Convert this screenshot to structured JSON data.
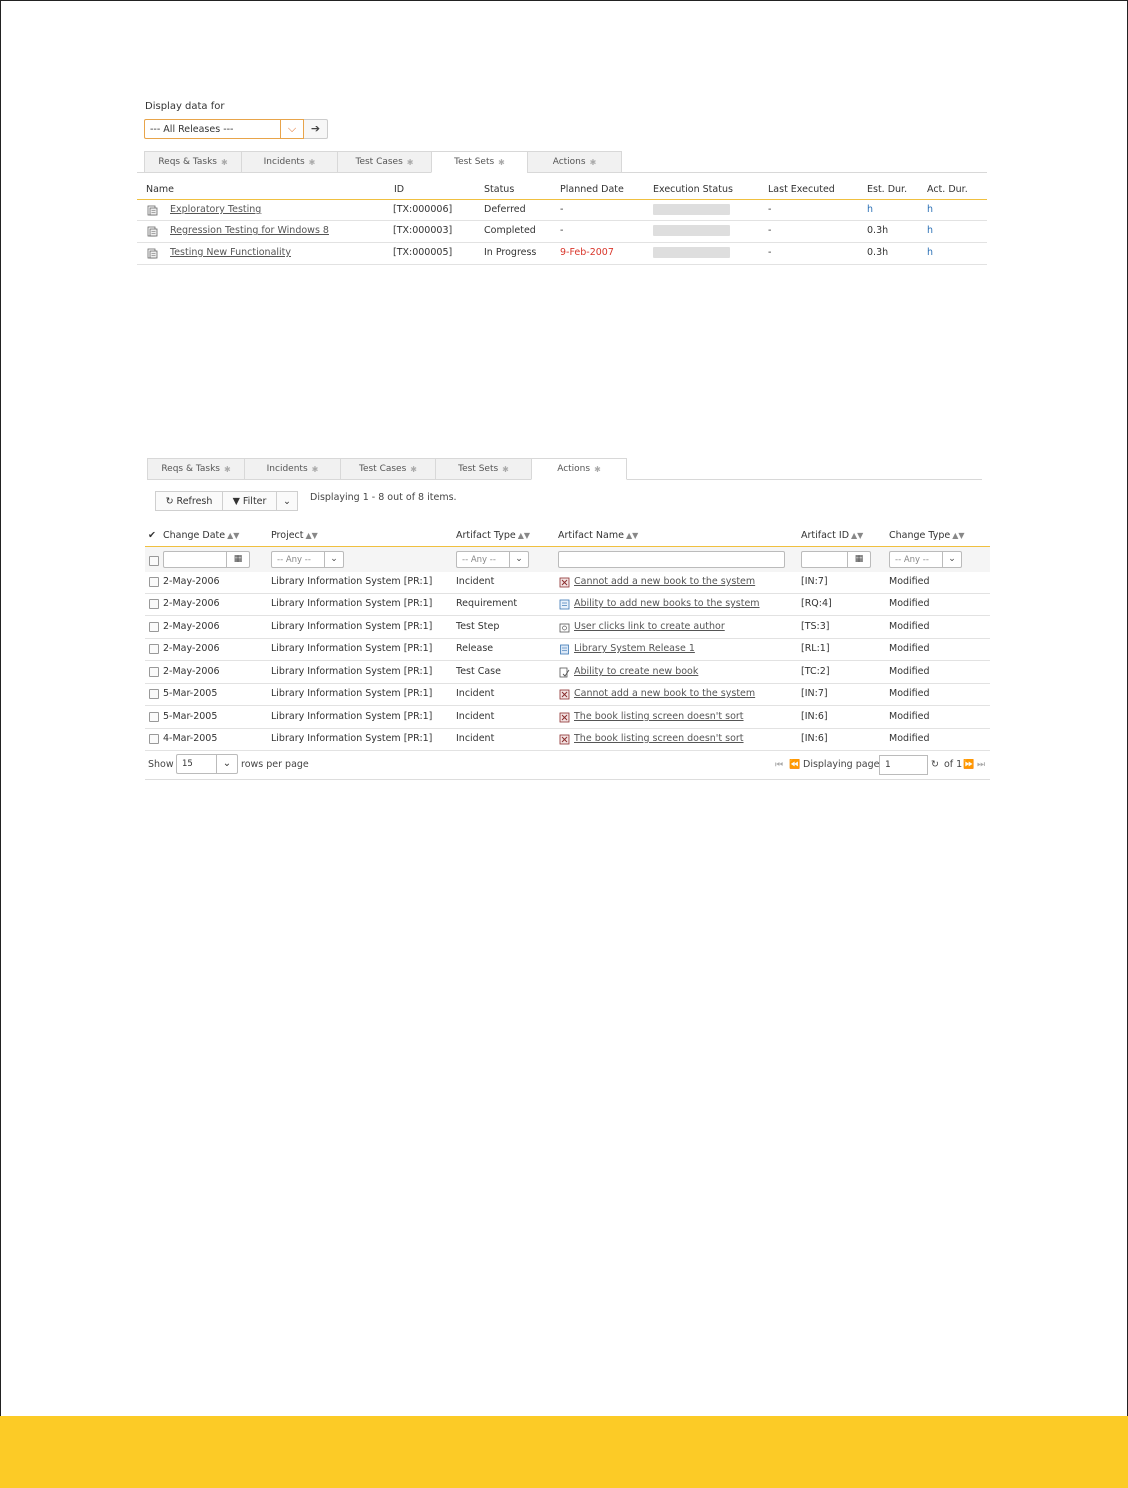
{
  "release_filter": {
    "label": "Display data for",
    "selected": "--- All Releases ---"
  },
  "tabs_top": [
    {
      "label": "Reqs & Tasks",
      "active": false
    },
    {
      "label": "Incidents",
      "active": false
    },
    {
      "label": "Test Cases",
      "active": false
    },
    {
      "label": "Test Sets",
      "active": true
    },
    {
      "label": "Actions",
      "active": false
    }
  ],
  "test_sets": {
    "columns": [
      "Name",
      "ID",
      "Status",
      "Planned Date",
      "Execution Status",
      "Last Executed",
      "Est. Dur.",
      "Act. Dur."
    ],
    "rows": [
      {
        "name": "Exploratory Testing",
        "id": "[TX:000006]",
        "status": "Deferred",
        "planned": "-",
        "last": "-",
        "est": "h",
        "act": "h"
      },
      {
        "name": "Regression Testing for Windows 8",
        "id": "[TX:000003]",
        "status": "Completed",
        "planned": "-",
        "last": "-",
        "est": "0.3h",
        "act": "h"
      },
      {
        "name": "Testing New Functionality",
        "id": "[TX:000005]",
        "status": "In Progress",
        "planned": "9-Feb-2007",
        "last": "-",
        "est": "0.3h",
        "act": "h"
      }
    ]
  },
  "tabs_bottom": [
    {
      "label": "Reqs & Tasks",
      "active": false
    },
    {
      "label": "Incidents",
      "active": false
    },
    {
      "label": "Test Cases",
      "active": false
    },
    {
      "label": "Test Sets",
      "active": false
    },
    {
      "label": "Actions",
      "active": true
    }
  ],
  "toolbar": {
    "refresh": "Refresh",
    "filter": "Filter",
    "count": "Displaying 1 - 8 out of 8 items."
  },
  "actions": {
    "columns": [
      "Change Date",
      "Project",
      "Artifact Type",
      "Artifact Name",
      "Artifact ID",
      "Change Type"
    ],
    "filter_any": "-- Any --",
    "rows": [
      {
        "date": "2-May-2006",
        "project": "Library Information System [PR:1]",
        "type": "Incident",
        "name": "Cannot add a new book to the system",
        "aid": "[IN:7]",
        "change": "Modified",
        "icon": "incident"
      },
      {
        "date": "2-May-2006",
        "project": "Library Information System [PR:1]",
        "type": "Requirement",
        "name": "Ability to add new books to the system",
        "aid": "[RQ:4]",
        "change": "Modified",
        "icon": "requirement"
      },
      {
        "date": "2-May-2006",
        "project": "Library Information System [PR:1]",
        "type": "Test Step",
        "name": "User clicks link to create author",
        "aid": "[TS:3]",
        "change": "Modified",
        "icon": "teststep"
      },
      {
        "date": "2-May-2006",
        "project": "Library Information System [PR:1]",
        "type": "Release",
        "name": "Library System Release 1",
        "aid": "[RL:1]",
        "change": "Modified",
        "icon": "release"
      },
      {
        "date": "2-May-2006",
        "project": "Library Information System [PR:1]",
        "type": "Test Case",
        "name": "Ability to create new book",
        "aid": "[TC:2]",
        "change": "Modified",
        "icon": "testcase"
      },
      {
        "date": "5-Mar-2005",
        "project": "Library Information System [PR:1]",
        "type": "Incident",
        "name": "Cannot add a new book to the system",
        "aid": "[IN:7]",
        "change": "Modified",
        "icon": "incident"
      },
      {
        "date": "5-Mar-2005",
        "project": "Library Information System [PR:1]",
        "type": "Incident",
        "name": "The book listing screen doesn't sort",
        "aid": "[IN:6]",
        "change": "Modified",
        "icon": "incident"
      },
      {
        "date": "4-Mar-2005",
        "project": "Library Information System [PR:1]",
        "type": "Incident",
        "name": "The book listing screen doesn't sort",
        "aid": "[IN:6]",
        "change": "Modified",
        "icon": "incident"
      }
    ]
  },
  "pager": {
    "show": "Show",
    "rows_value": "15",
    "rows_per_page": "rows per page",
    "displaying_page": "Displaying page",
    "page_value": "1",
    "of": "of 1"
  },
  "colors": {
    "accent_yellow": "#fccb26",
    "header_line": "#f0c040",
    "planned_red": "#d9362b",
    "duration_blue": "#2a6fb5"
  }
}
